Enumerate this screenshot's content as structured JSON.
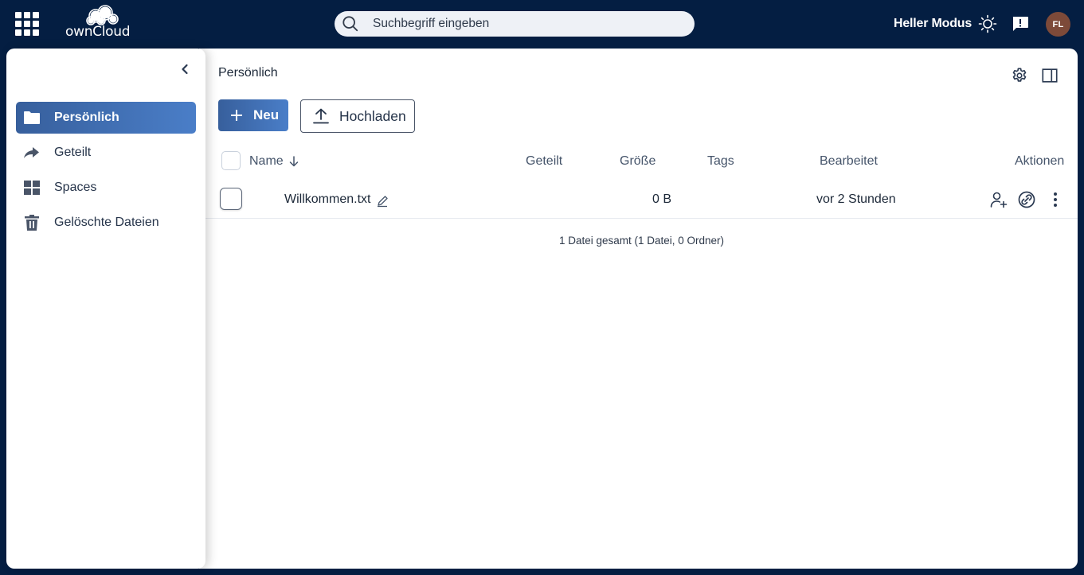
{
  "header": {
    "brand": "ownCloud",
    "search_placeholder": "Suchbegriff eingeben",
    "theme_label": "Heller Modus",
    "avatar_initials": "FL",
    "avatar_color": "#7d4a39",
    "accent_color": "#041e42"
  },
  "sidebar": {
    "items": [
      {
        "label": "Persönlich",
        "icon": "folder-icon",
        "active": true
      },
      {
        "label": "Geteilt",
        "icon": "share-arrow-icon",
        "active": false
      },
      {
        "label": "Spaces",
        "icon": "spaces-grid-icon",
        "active": false
      },
      {
        "label": "Gelöschte Dateien",
        "icon": "trash-icon",
        "active": false
      }
    ]
  },
  "main": {
    "breadcrumb": "Persönlich",
    "new_button": "Neu",
    "upload_button": "Hochladen",
    "columns": {
      "name": "Name",
      "shared": "Geteilt",
      "size": "Größe",
      "tags": "Tags",
      "modified": "Bearbeitet",
      "actions": "Aktionen"
    },
    "files": [
      {
        "name": "Willkommen.txt",
        "size": "0 B",
        "modified": "vor 2 Stunden"
      }
    ],
    "footer": "1 Datei gesamt (1 Datei, 0 Ordner)"
  }
}
